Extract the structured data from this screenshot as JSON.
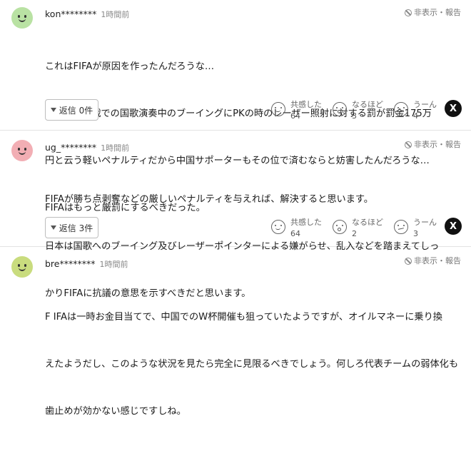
{
  "report_label": "非表示・報告",
  "comments": [
    {
      "user": "kon********",
      "time": "1時間前",
      "avatar_color": "#b9e2a3",
      "lines": [
        "これはFIFAが原因を作ったんだろうな…",
        "バーレーン戦での国歌演奏中のブーイングにPKの時のレーザー照射に対する罰が罰金175万",
        "円と云う軽いペナルティだから中国サポーターもその位で済むならと妨害したんだろうな…",
        "FIFAはもっと厳罰にするべきだった。"
      ],
      "reply_label": "返信 0件",
      "reactions": [
        {
          "label": "共感した",
          "count": "64",
          "icon": "smile-face-icon"
        },
        {
          "label": "なるほど",
          "count": "3",
          "icon": "surprised-face-icon"
        },
        {
          "label": "うーん",
          "count": "4",
          "icon": "hmm-face-icon"
        }
      ]
    },
    {
      "user": "ug_********",
      "time": "1時間前",
      "avatar_color": "#f2aeb4",
      "lines": [
        "FIFAが勝ち点剥奪などの厳しいペナルティを与えれば、解決すると思います。",
        "日本は国歌へのブーイング及びレーザーポインターによる嫌がらせ、乱入などを踏まえてしっ",
        "かりFIFAに抗議の意思を示すべきだと思います。"
      ],
      "reply_label": "返信 3件",
      "reactions": [
        {
          "label": "共感した",
          "count": "64",
          "icon": "smile-face-icon"
        },
        {
          "label": "なるほど",
          "count": "2",
          "icon": "surprised-face-icon"
        },
        {
          "label": "うーん",
          "count": "3",
          "icon": "hmm-face-icon"
        }
      ]
    },
    {
      "user": "bre********",
      "time": "1時間前",
      "avatar_color": "#c9dc7e",
      "lines": [
        "F IFAは一時お金目当てで、中国でのW杯開催も狙っていたようですが、オイルマネーに乗り換",
        "えたようだし、このような状況を見たら完全に見限るべきでしょう。何しろ代表チームの弱体化も",
        "歯止めが効かない感じですしね。"
      ]
    }
  ],
  "share_x_label": "X"
}
